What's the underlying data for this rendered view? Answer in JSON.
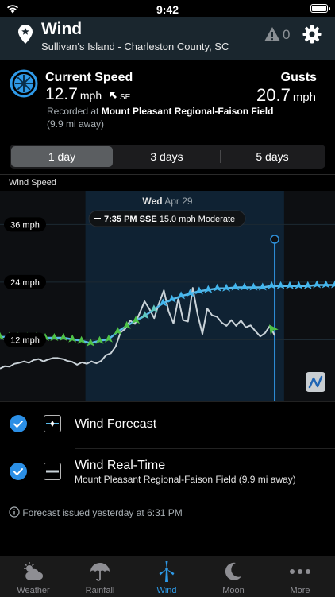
{
  "status_bar": {
    "time": "9:42"
  },
  "header": {
    "title": "Wind",
    "subtitle": "Sullivan's Island - Charleston County, SC",
    "alert_count": "0"
  },
  "current": {
    "title": "Current Speed",
    "speed": "12.7",
    "unit": "mph",
    "direction": "SE",
    "recorded_prefix": "Recorded at ",
    "station": "Mount Pleasant Regional-Faison Field",
    "distance": "(9.9 mi away)",
    "gusts_label": "Gusts",
    "gusts_value": "20.7",
    "gusts_unit": "mph"
  },
  "range_tabs": [
    {
      "label": "1 day",
      "selected": true
    },
    {
      "label": "3 days",
      "selected": false
    },
    {
      "label": "5 days",
      "selected": false
    }
  ],
  "chart_label": "Wind Speed",
  "chart_data": {
    "type": "line",
    "y_axis_labels": [
      "36 mph",
      "24 mph",
      "12 mph"
    ],
    "yunit": "mph",
    "ylim": [
      0,
      43
    ],
    "day_label": {
      "day": "Wed",
      "date": "Apr 29"
    },
    "tooltip": {
      "time": "7:35 PM",
      "direction": "SSE",
      "speed": "15.0 mph",
      "category": "Moderate"
    },
    "series": [
      {
        "name": "Wind Forecast",
        "color": "#5ab9e8",
        "values": [
          12.6,
          12.6,
          12.6,
          12.6,
          12.6,
          12.4,
          12.4,
          12.4,
          12.1,
          11.8,
          11.3,
          11.8,
          12.1,
          13.7,
          14.9,
          16.0,
          17.0,
          18.3,
          19.6,
          20.4,
          21.1,
          21.6,
          22.1,
          22.4,
          22.7,
          22.7,
          22.9,
          22.9,
          22.9,
          22.9,
          23.2,
          23.2,
          23.2,
          23.2,
          23.2,
          23.4,
          23.4,
          23.4
        ]
      },
      {
        "name": "Wind Real-Time",
        "color": "#c9d2d8",
        "values": [
          6,
          6.5,
          6.4,
          7,
          7.2,
          7.5,
          7.2,
          7.8,
          8,
          7.5,
          7.9,
          8.2,
          8.2,
          8,
          7.6,
          7.4,
          6.8,
          7.3,
          7,
          7.5,
          7.1,
          7.6,
          8.8,
          9.2,
          10.6,
          13.5,
          14.3,
          16,
          15.3,
          17.6,
          20,
          18.4,
          16.5,
          19.6,
          22.3,
          17.9,
          15.4,
          20.6,
          16.1,
          15.8,
          22.8,
          17.3,
          13.2,
          18.5,
          17.1,
          16.8,
          15.6,
          14.9,
          16.1,
          14.9,
          16,
          14.6,
          15,
          13.8,
          12.7,
          13.4,
          14.9,
          12.9
        ]
      }
    ],
    "current_time_fraction": 0.82,
    "day_band_fraction": [
      0.255,
      0.848
    ]
  },
  "legend": [
    {
      "label": "Wind Forecast",
      "sublabel": ""
    },
    {
      "label": "Wind Real-Time",
      "sublabel": "Mount Pleasant Regional-Faison Field (9.9 mi away)"
    }
  ],
  "footnote": "Forecast issued yesterday at 6:31 PM",
  "tabbar": [
    {
      "label": "Weather",
      "icon": "weather-icon",
      "active": false
    },
    {
      "label": "Rainfall",
      "icon": "umbrella-icon",
      "active": false
    },
    {
      "label": "Wind",
      "icon": "wind-turbine-icon",
      "active": true
    },
    {
      "label": "Moon",
      "icon": "moon-icon",
      "active": false
    },
    {
      "label": "More",
      "icon": "more-icon",
      "active": false
    }
  ]
}
